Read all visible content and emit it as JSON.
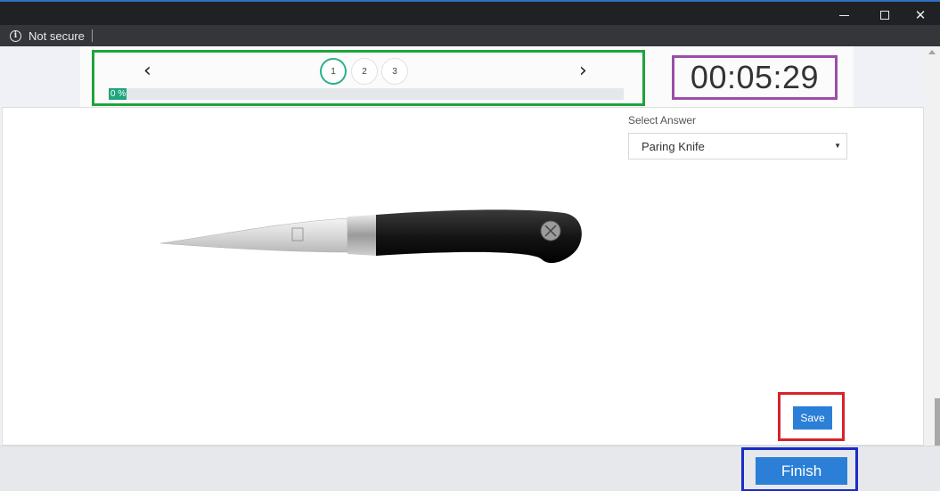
{
  "browser": {
    "security_label": "Not secure",
    "info_icon": "info-circle-icon",
    "window_controls": [
      "minimize-icon",
      "maximize-icon",
      "close-icon"
    ]
  },
  "quiz": {
    "nav_prev": "‹",
    "nav_next": "›",
    "questions": [
      "1",
      "2",
      "3"
    ],
    "active_question": "1",
    "progress_label": "0 %",
    "progress_percent": 0,
    "timer": "00:05:29"
  },
  "question": {
    "image": "paring-knife-image",
    "select_label": "Select Answer",
    "selected_answer": "Paring Knife"
  },
  "actions": {
    "save_label": "Save",
    "finish_label": "Finish"
  },
  "colors": {
    "accent": "#2b7fd6",
    "progress": "#21a57e",
    "highlight_green": "#1fa33c",
    "highlight_purple": "#9b4ea7",
    "highlight_red": "#d8222b",
    "highlight_blue": "#1a2bc8"
  }
}
